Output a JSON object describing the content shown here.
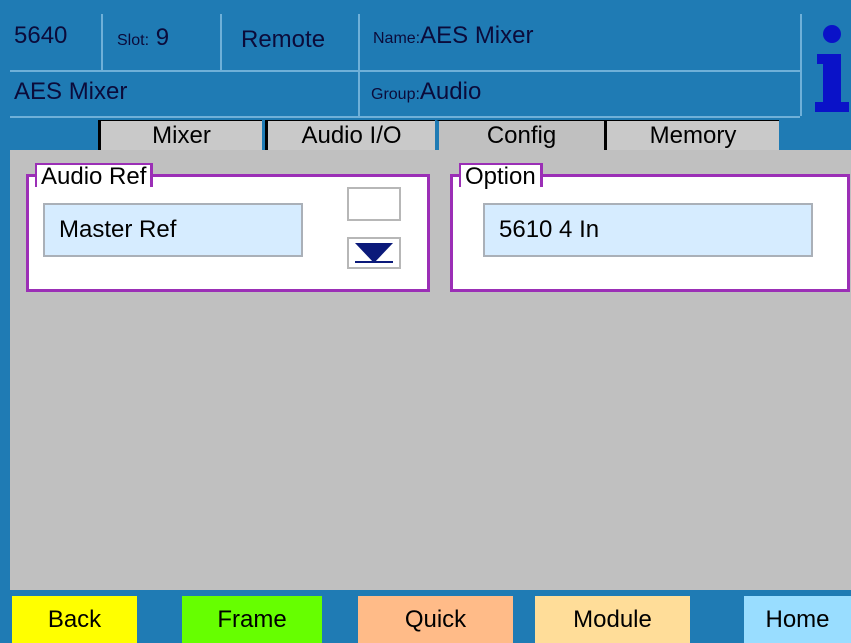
{
  "header": {
    "model": "5640",
    "slot_label": "Slot:",
    "slot_value": "9",
    "mode": "Remote",
    "name_label": "Name:",
    "name_value": "AES Mixer",
    "module_name": "AES Mixer",
    "group_label": "Group:",
    "group_value": "Audio",
    "info_icon": "info-icon"
  },
  "tabs": [
    {
      "label": "Mixer",
      "active": false
    },
    {
      "label": "Audio I/O",
      "active": false
    },
    {
      "label": "Config",
      "active": true
    },
    {
      "label": "Memory",
      "active": false
    }
  ],
  "audio_ref": {
    "title": "Audio Ref",
    "value": "Master Ref",
    "dropdown_icon": "triangle-down-icon"
  },
  "option": {
    "title": "Option",
    "value": "5610 4 In"
  },
  "footer": {
    "buttons": [
      {
        "label": "Back",
        "color": "#ffff00"
      },
      {
        "label": "Frame",
        "color": "#66ff00"
      },
      {
        "label": "Quick",
        "color": "#ffbb88"
      },
      {
        "label": "Module",
        "color": "#ffdd99"
      },
      {
        "label": "Home",
        "color": "#99ddff"
      }
    ]
  },
  "colors": {
    "header_bg": "#1f7bb4",
    "content_bg": "#c0c0c0",
    "group_border": "#9b2fb6",
    "field_bg": "#d6ecff",
    "icon_blue": "#0a12c8"
  }
}
